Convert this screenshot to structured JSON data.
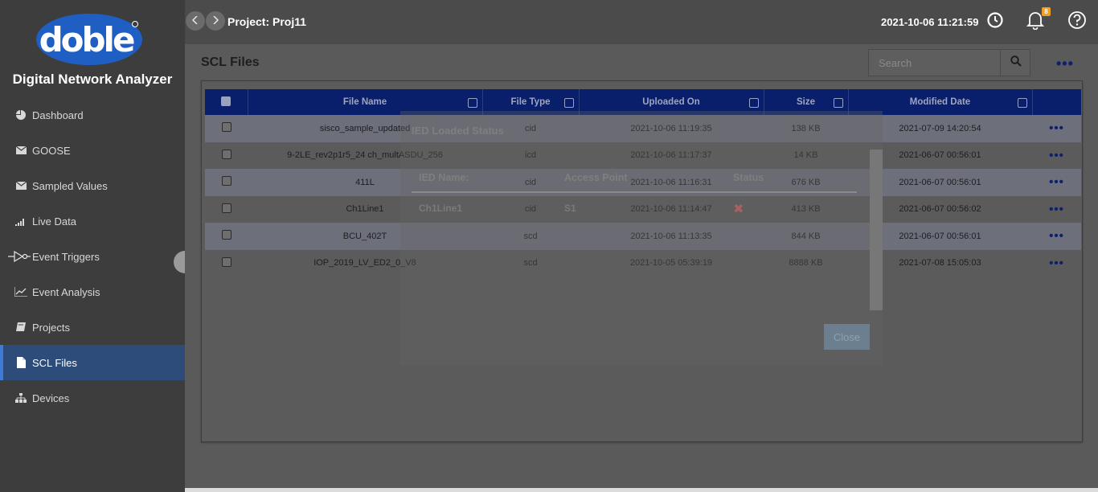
{
  "app": {
    "logo_text": "doble",
    "title": "Digital Network Analyzer"
  },
  "sidebar": {
    "items": [
      {
        "label": "Dashboard",
        "icon": "pie-chart-icon"
      },
      {
        "label": "GOOSE",
        "icon": "envelope-icon"
      },
      {
        "label": "Sampled Values",
        "icon": "envelope-icon"
      },
      {
        "label": "Live Data",
        "icon": "signal-bars-icon"
      },
      {
        "label": "Event Triggers",
        "icon": "trigger-icon"
      },
      {
        "label": "Event Analysis",
        "icon": "line-chart-icon"
      },
      {
        "label": "Projects",
        "icon": "book-icon"
      },
      {
        "label": "SCL Files",
        "icon": "file-icon",
        "active": true
      },
      {
        "label": "Devices",
        "icon": "sitemap-icon"
      }
    ]
  },
  "header": {
    "project": "Project: Proj11",
    "datetime": "2021-10-06 11:21:59",
    "notification_count": "8"
  },
  "main": {
    "title": "SCL Files",
    "search_placeholder": "Search",
    "page_menu": "•••"
  },
  "table": {
    "columns": [
      "File Name",
      "File Type",
      "Uploaded On",
      "Size",
      "Modified Date"
    ],
    "rows": [
      {
        "name": "sisco_sample_updated",
        "type": "cid",
        "uploaded": "2021-10-06 11:19:35",
        "size": "138 KB",
        "modified": "2021-07-09 14:20:54"
      },
      {
        "name": "9-2LE_rev2p1r5_24 ch_multASDU_256",
        "type": "icd",
        "uploaded": "2021-10-06 11:17:37",
        "size": "14 KB",
        "modified": "2021-06-07 00:56:01"
      },
      {
        "name": "411L",
        "type": "cid",
        "uploaded": "2021-10-06 11:16:31",
        "size": "676 KB",
        "modified": "2021-06-07 00:56:01"
      },
      {
        "name": "Ch1Line1",
        "type": "cid",
        "uploaded": "2021-10-06 11:14:47",
        "size": "413 KB",
        "modified": "2021-06-07 00:56:02"
      },
      {
        "name": "BCU_402T",
        "type": "scd",
        "uploaded": "2021-10-06 11:13:35",
        "size": "844 KB",
        "modified": "2021-06-07 00:56:01"
      },
      {
        "name": "IOP_2019_LV_ED2_0_V8",
        "type": "scd",
        "uploaded": "2021-10-05 05:39:19",
        "size": "8888 KB",
        "modified": "2021-07-08 15:05:03"
      }
    ],
    "row_menu": "•••"
  },
  "dialog": {
    "title": "IED Loaded Status",
    "col_ied": "IED Name:",
    "col_access": "Access Point",
    "col_status": "Status",
    "ied_name": "Ch1Line1",
    "access_point": "S1",
    "status_mark": "✖",
    "close_label": "Close"
  },
  "colors": {
    "header_blue": "#0a1f6b",
    "active_nav": "#2e4c7a",
    "badge": "#f0a020"
  }
}
